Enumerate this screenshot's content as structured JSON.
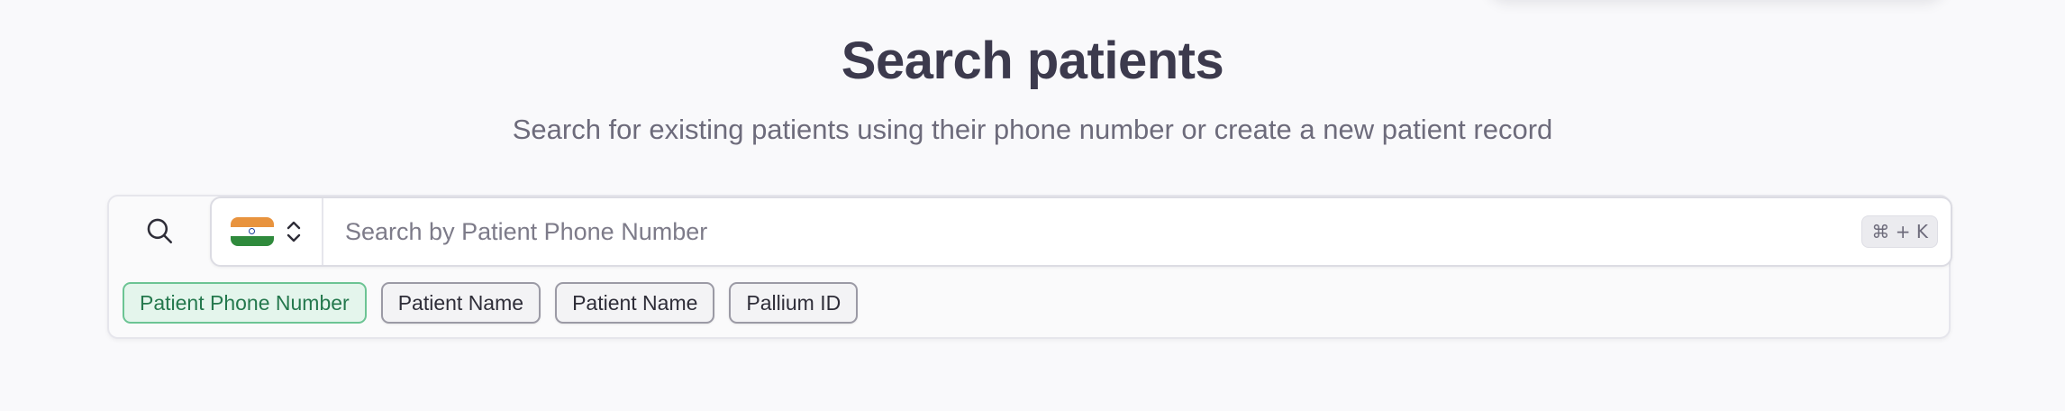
{
  "header": {
    "title": "Search patients",
    "subtitle": "Search for existing patients using their phone number or create a new patient record"
  },
  "search": {
    "search_icon": "search-icon",
    "country": {
      "selected": "India",
      "flag_icon": "india-flag-icon",
      "toggle_icon": "chevron-up-down-icon"
    },
    "placeholder": "Search by Patient Phone Number",
    "value": "",
    "shortcut": "⌘ + K"
  },
  "filters": {
    "active_color": "#24784d",
    "items": [
      {
        "label": "Patient Phone Number",
        "active": true
      },
      {
        "label": "Patient Name",
        "active": false
      },
      {
        "label": "Patient Name",
        "active": false
      },
      {
        "label": "Pallium ID",
        "active": false
      }
    ]
  }
}
